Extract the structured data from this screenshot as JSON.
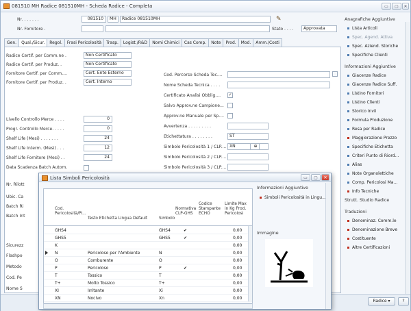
{
  "window": {
    "title": "081510 MH Radice 081510MH - Scheda Radice - Completa",
    "min_label": "▭",
    "max_label": "▢",
    "close_label": "✕"
  },
  "header": {
    "nr_label": "Nr. . . . . . .",
    "nr_value": "081510",
    "nr_code": "MH",
    "nr_desc": "Radice 081510MH",
    "fornitore_label": "Nr. Fornitore .",
    "stato_label": "Stato . . . .",
    "stato_value": "Approvata"
  },
  "tabs": [
    "Gen.",
    "Qual./Sicur.",
    "Regol.",
    "Frasi Pericolosità",
    "Trasp.",
    "Logist./R&D",
    "Nomi Chimici",
    "Cas Comp.",
    "Note",
    "Prod.",
    "Mod.",
    "Amm./Costi"
  ],
  "left_fields": [
    {
      "label": "Radice Certif. per Comm.ne .",
      "value": "Non Certificato"
    },
    {
      "label": "Radice Certif. per Produz. .",
      "value": "Non Certificato"
    },
    {
      "label": "Fornitore Certif. per Comm....",
      "value": "Cert. Ente Esterno"
    },
    {
      "label": "Fornitore Certif. per Produz. .",
      "value": "Cert. Interno"
    }
  ],
  "left_numeric": [
    {
      "label": "Livello Controllo Merce . . . .",
      "value": "0"
    },
    {
      "label": "Progr. Controllo Merce. . . . .",
      "value": "0"
    },
    {
      "label": "Shelf Life (Mesi) . . . . . . .",
      "value": "24"
    },
    {
      "label": "Shelf Life Interm. (Mesi) . . .",
      "value": "12"
    },
    {
      "label": "Shelf Life Fornitore (Mesi) . .",
      "value": "24"
    }
  ],
  "data_scadenza_label": "Data Scadenza Batch Autom.",
  "left_truncated": [
    "Nr. Rilott",
    "Ubic. Ca",
    "Batch Ri",
    "Batch Int",
    "Sicurezz",
    "Flashpo",
    "Metodo",
    "Cod. Pe",
    "Nome S"
  ],
  "mid_fields": [
    {
      "label": "Cod. Percorso Scheda Tec....",
      "type": "input",
      "value": ""
    },
    {
      "label": "Nome Scheda Tecnica . . . .",
      "type": "input",
      "value": ""
    },
    {
      "label": "Certificato Analisi Obblig....",
      "type": "check",
      "value": "✓"
    },
    {
      "label": "Salvo Approv.ne Campione...",
      "type": "check",
      "value": ""
    },
    {
      "label": "Approv.ne Manuale per Sp....",
      "type": "check",
      "value": ""
    },
    {
      "label": "Avvertenza . . . . . . . . .",
      "type": "input",
      "value": ""
    },
    {
      "label": "Etichettatura . . . . . . . .",
      "type": "input",
      "value": "ST"
    },
    {
      "label": "Simbolo Pericolosità 1 / CLP....",
      "type": "input",
      "value": "XN"
    },
    {
      "label": "Simbolo Pericolosità 2 / CLP....",
      "type": "input",
      "value": ""
    },
    {
      "label": "Simbolo Pericolosità 3 / CLP....",
      "type": "input",
      "value": ""
    }
  ],
  "right_panel": {
    "sec1": "Anagrafiche Aggiuntive",
    "sec1_items": [
      {
        "label": "Lista Articoli",
        "disabled": false
      },
      {
        "label": "Spec. Agend. Attiva",
        "disabled": true
      },
      {
        "label": "Spec. Aziend. Storiche",
        "disabled": false
      },
      {
        "label": "Specifiche Clienti",
        "disabled": false
      }
    ],
    "sec2": "Informazioni Aggiuntive",
    "sec2_items": [
      "Giacenze Radice",
      "Giacenze Radice Suff.",
      "Listino Fornitori",
      "Listino Clienti",
      "Storico Invii",
      "Formula Produzione",
      "Resa per Radice",
      "Maggiorazione Prezzo",
      "Specifiche Etichetta",
      "Criteri Punto di Riord...",
      "Alias",
      "Note Organolettiche",
      "Comp. Pericolosi Ma...",
      "Info Tecniche"
    ],
    "strutt": "Strutt. Studio Radice",
    "sec3": "Traduzioni",
    "sec3_items": [
      "Denominaz. Comm.le",
      "Denominazione Breve",
      "Costituente",
      "Altre Certificazioni"
    ]
  },
  "bottom": {
    "radice_button": "Radice",
    "arrow": "▾"
  },
  "popup": {
    "title": "Lista Simboli Pericolosità",
    "headers": {
      "cod": "Cod. Pericolosità/Pi...",
      "testo": "Testo Etichetta Lingua Default",
      "simbolo": "Simbolo",
      "normativa": "Normativa CLP-GHS",
      "codice": "Codice Stampante ECHO",
      "limite": "Limite Max in Kg Prod. Pericolosi"
    },
    "rows": [
      {
        "cod": "GHS4",
        "testo": "",
        "simbolo": "GHS4",
        "norm": "✔",
        "codice": "",
        "limite": "0,00"
      },
      {
        "cod": "GHS5",
        "testo": "",
        "simbolo": "GHS5",
        "norm": "✔",
        "codice": "",
        "limite": "0,00"
      },
      {
        "cod": "K",
        "testo": "",
        "simbolo": "",
        "norm": "",
        "codice": "",
        "limite": "0,00"
      },
      {
        "cod": "N",
        "testo": "Pericoloso per l'Ambiente",
        "simbolo": "N",
        "norm": "",
        "codice": "",
        "limite": "0,00"
      },
      {
        "cod": "O",
        "testo": "Comburente",
        "simbolo": "O",
        "norm": "",
        "codice": "",
        "limite": "0,00"
      },
      {
        "cod": "P",
        "testo": "Pericoloso",
        "simbolo": "P",
        "norm": "✔",
        "codice": "",
        "limite": "0,00"
      },
      {
        "cod": "T",
        "testo": "Tossico",
        "simbolo": "T",
        "norm": "",
        "codice": "",
        "limite": "0,00"
      },
      {
        "cod": "T+",
        "testo": "Molto Tossico",
        "simbolo": "T+",
        "norm": "",
        "codice": "",
        "limite": "0,00"
      },
      {
        "cod": "XI",
        "testo": "Irritante",
        "simbolo": "Xi",
        "norm": "",
        "codice": "",
        "limite": "0,00"
      },
      {
        "cod": "XN",
        "testo": "Nocivo",
        "simbolo": "Xn",
        "norm": "",
        "codice": "",
        "limite": "0,00"
      }
    ],
    "side_title": "Informazioni Aggiuntive",
    "side_link": "Simboli Pericolosità in Lingu...",
    "image_label": "Immagine"
  }
}
